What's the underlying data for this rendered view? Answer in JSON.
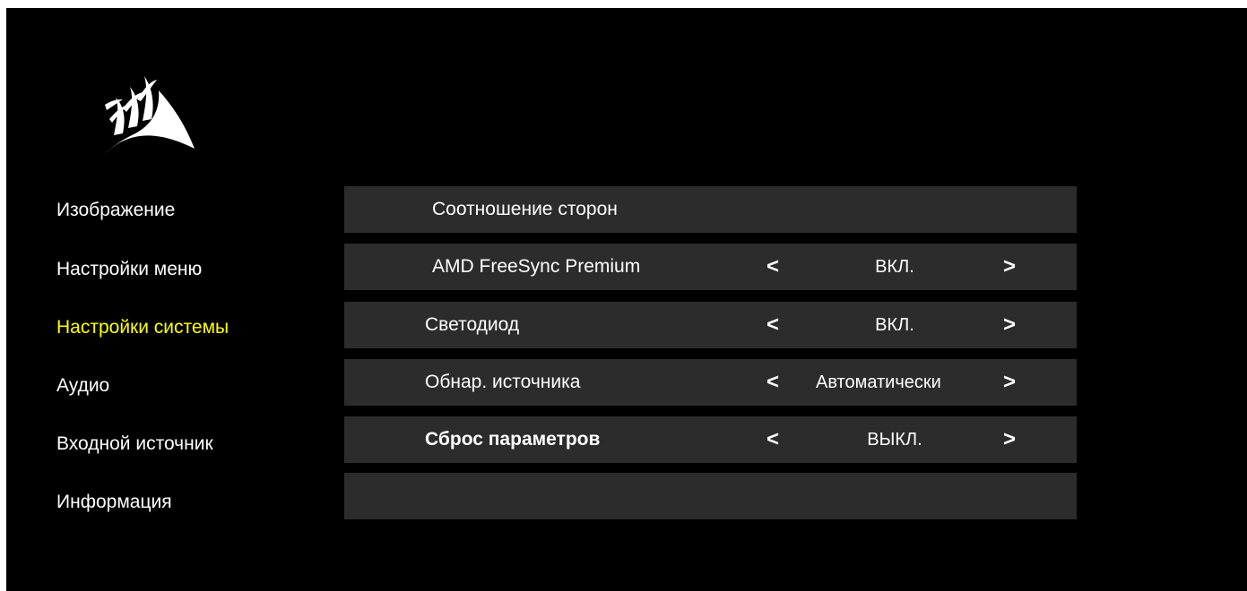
{
  "logo": {
    "icon": "corsair-sails-icon",
    "color": "#ffffff"
  },
  "menu": {
    "items": [
      {
        "label": "Изображение",
        "active": false
      },
      {
        "label": "Настройки меню",
        "active": false
      },
      {
        "label": "Настройки системы",
        "active": true
      },
      {
        "label": "Аудио",
        "active": false
      },
      {
        "label": "Входной источник",
        "active": false
      },
      {
        "label": "Информация",
        "active": false
      }
    ],
    "active_color": "#ffff00"
  },
  "settings": {
    "rows": [
      {
        "label": "Соотношение сторон"
      },
      {
        "label": "AMD FreeSync Premium",
        "prev": "<",
        "value": "ВКЛ.",
        "next": ">"
      },
      {
        "label": "Светодиод",
        "prev": "<",
        "value": "ВКЛ.",
        "next": ">"
      },
      {
        "label": "Обнар. источника",
        "prev": "<",
        "value": "Автоматически",
        "next": ">"
      },
      {
        "label": "Сброс параметров",
        "prev": "<",
        "value": "ВЫКЛ.",
        "next": ">"
      },
      {
        "label": ""
      }
    ],
    "row_color": "#2c2c2c"
  }
}
